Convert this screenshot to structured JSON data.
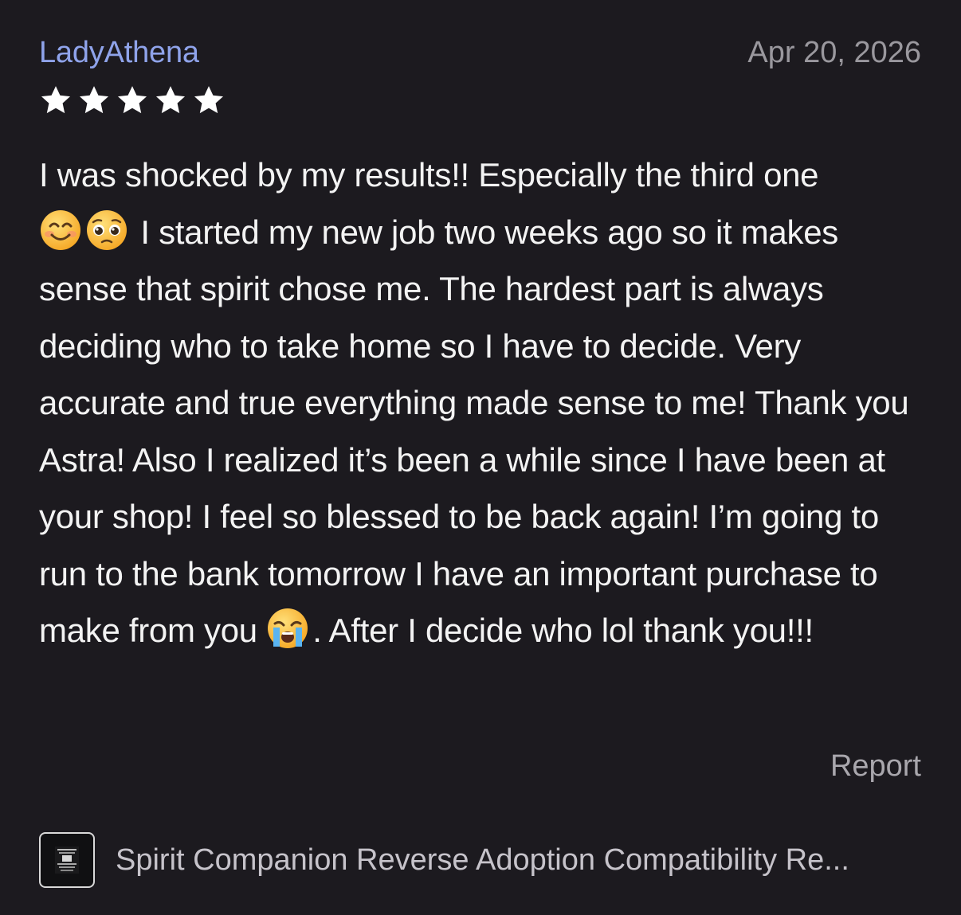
{
  "review": {
    "author": "LadyAthena",
    "date": "Apr 20, 2026",
    "rating": 5,
    "rating_max": 5,
    "text_segments": {
      "s1": "I was shocked by my results!! Especially the third one ",
      "s2": " I started my new job two weeks ago so it makes sense that spirit chose me. The hardest part is always deciding who to take home so I have to decide. Very accurate and true everything made sense to me! Thank you Astra! Also I realized it’s been a while since I have been at your shop! I feel so blessed to be back again! I’m going to run to the bank tomorrow I have an important purchase to make from you ",
      "s3": ". After I decide who lol thank you!!!"
    },
    "emojis": [
      "smiling-face-emoji",
      "pleading-face-emoji",
      "loudly-crying-face-emoji"
    ]
  },
  "actions": {
    "report_label": "Report"
  },
  "product": {
    "title": "Spirit Companion Reverse Adoption Compatibility Re..."
  },
  "colors": {
    "background": "#1c1a1f",
    "author": "#8fa3ea",
    "date": "#9a989e",
    "text": "#f3f3f3",
    "star": "#ffffff"
  }
}
